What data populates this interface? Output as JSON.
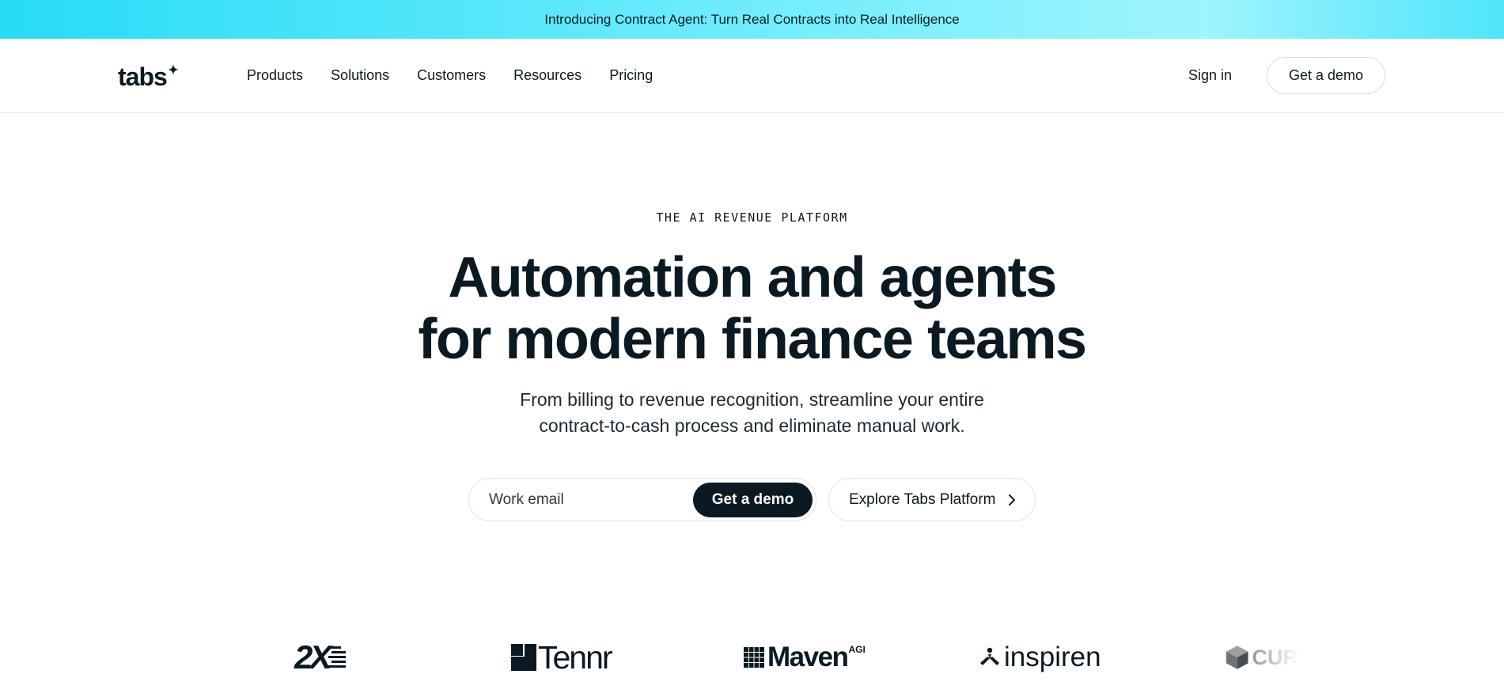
{
  "announcement": {
    "text": "Introducing Contract Agent: Turn Real Contracts into Real Intelligence"
  },
  "header": {
    "logo_text": "tabs",
    "nav": [
      {
        "label": "Products"
      },
      {
        "label": "Solutions"
      },
      {
        "label": "Customers"
      },
      {
        "label": "Resources"
      },
      {
        "label": "Pricing"
      }
    ],
    "sign_in_label": "Sign in",
    "demo_label": "Get a demo"
  },
  "hero": {
    "eyebrow": "THE AI REVENUE PLATFORM",
    "headline_line1": "Automation and agents",
    "headline_line2": "for modern finance teams",
    "subhead_line1": "From billing to revenue recognition, streamline your entire",
    "subhead_line2": "contract-to-cash process and eliminate manual work.",
    "email_placeholder": "Work email",
    "demo_button": "Get a demo",
    "explore_button": "Explore Tabs Platform"
  },
  "customer_logos": [
    {
      "name": "2X",
      "icon": "2x-logo"
    },
    {
      "name": "Tennr",
      "icon": "tennr-logo"
    },
    {
      "name": "Maven",
      "suffix": "AGI",
      "icon": "maven-logo"
    },
    {
      "name": "inspiren",
      "icon": "inspiren-logo"
    },
    {
      "name": "CUR",
      "icon": "cube-logo"
    }
  ],
  "colors": {
    "text": "#0b1a22",
    "banner_start": "#27dcf6",
    "banner_end": "#9ff4fe",
    "button_dark": "#0b1a22",
    "border": "#dfe3e6"
  }
}
